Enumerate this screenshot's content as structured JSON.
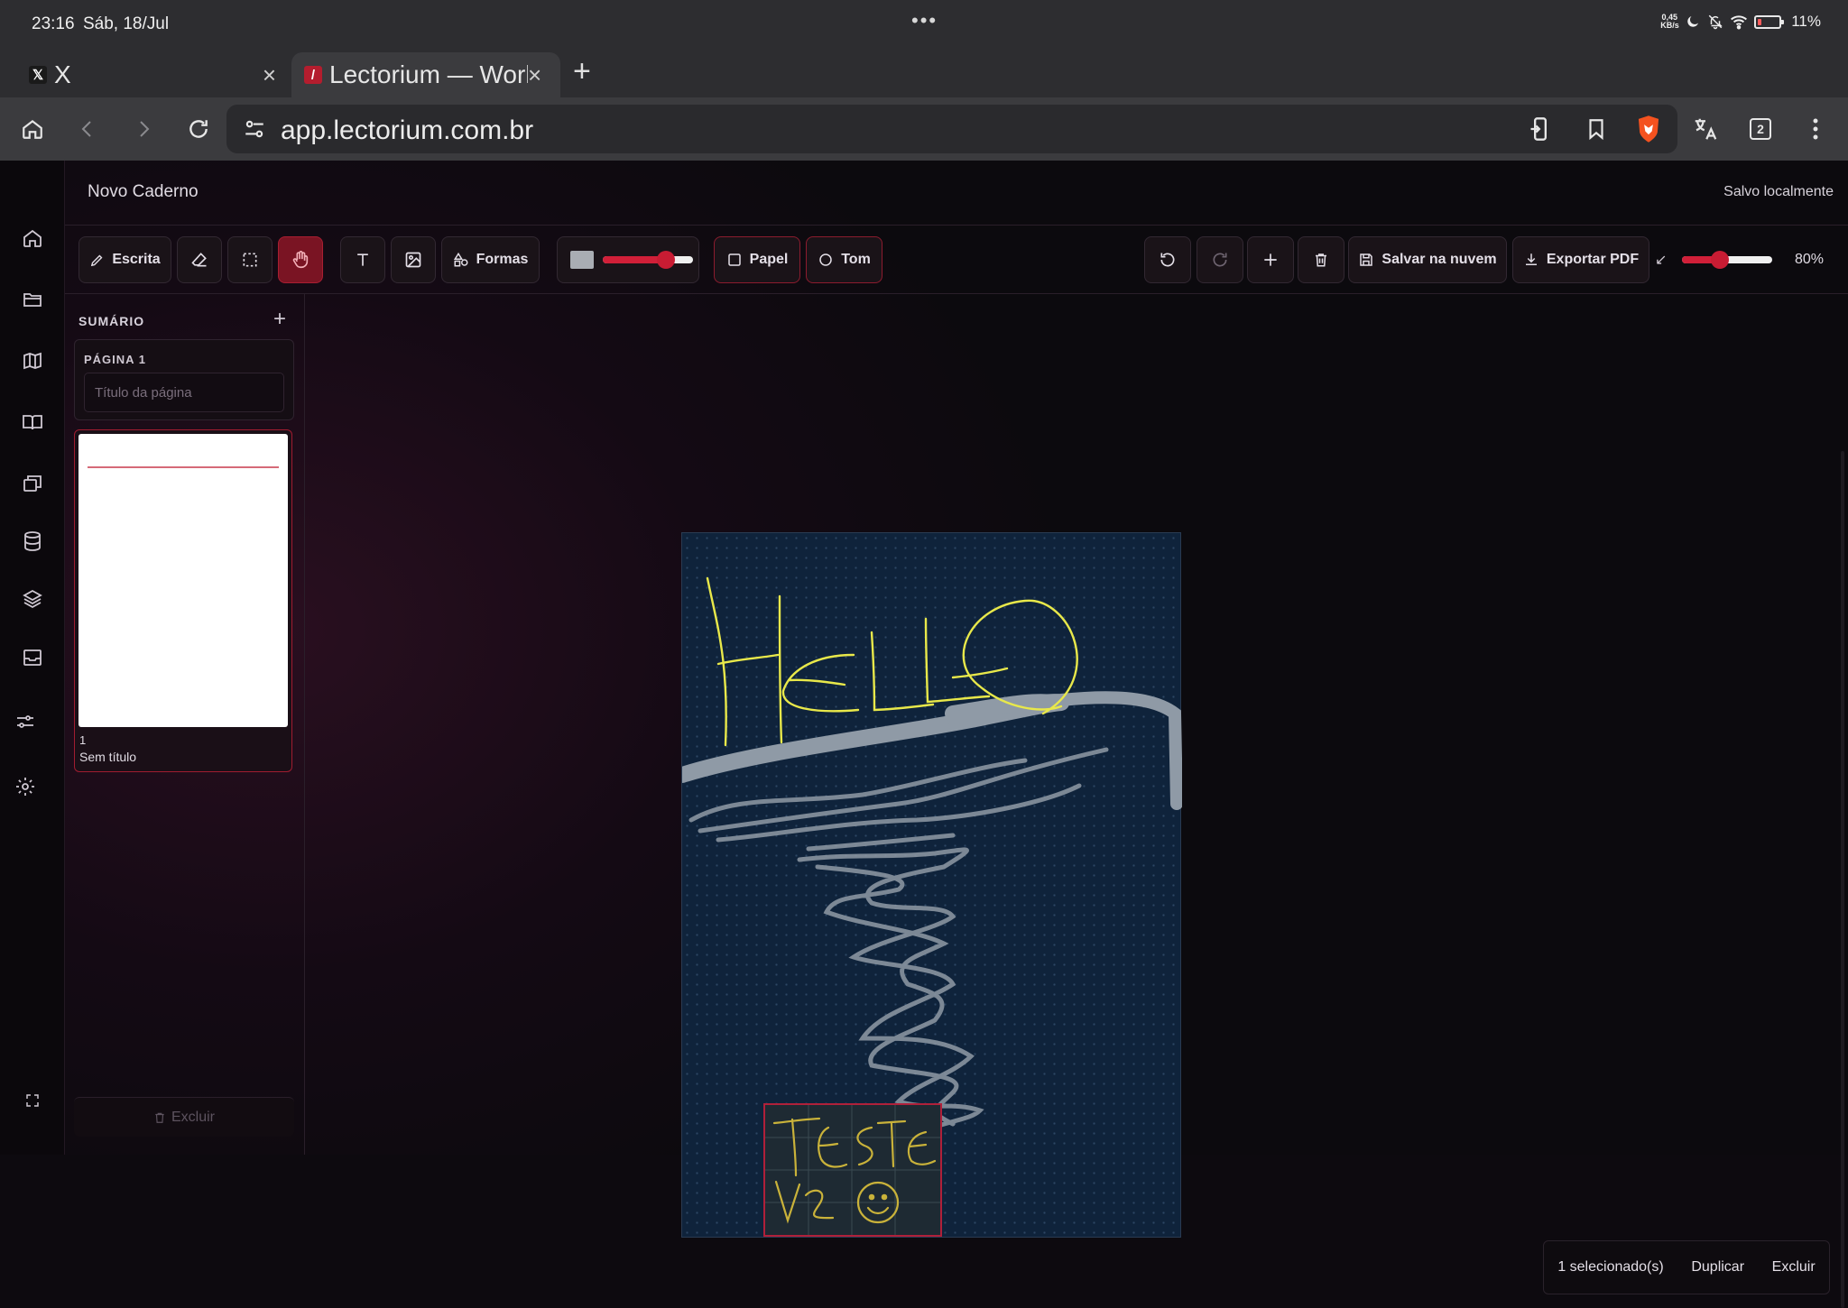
{
  "status": {
    "time": "23:16",
    "date": "Sáb, 18/Jul",
    "netspeed": "0,45 KB/s",
    "battery": "11%"
  },
  "tabs": [
    {
      "title": "X"
    },
    {
      "title": "Lectorium — Workspace"
    }
  ],
  "browser": {
    "url": "app.lectorium.com.br",
    "tab_count": "2"
  },
  "app": {
    "title": "Novo Caderno",
    "save_status": "Salvo localmente"
  },
  "tools": {
    "write": "Escrita",
    "shapes": "Formas",
    "paper": "Papel",
    "tone": "Tom",
    "save_cloud": "Salvar na nuvem",
    "export_pdf": "Exportar PDF",
    "zoom": "80%",
    "stroke_color": "#a9adb3",
    "stroke_width_fraction": 0.7,
    "zoom_fraction": 0.42
  },
  "sidebar": {
    "heading": "SUMÁRIO",
    "page_label": "PÁGINA 1",
    "title_placeholder": "Título da página",
    "thumb_number": "1",
    "thumb_name": "Sem título",
    "delete_label": "Excluir"
  },
  "canvas": {
    "handwriting": "HELLO",
    "inserted_note": "TESTE V2"
  },
  "selection": {
    "count": "1 selecionado(s)",
    "duplicate": "Duplicar",
    "delete": "Excluir"
  },
  "colors": {
    "accent": "#c81c33",
    "page": "#0f233b",
    "ink_yellow": "#e8e84a",
    "ink_gray": "#8f9aa6"
  }
}
